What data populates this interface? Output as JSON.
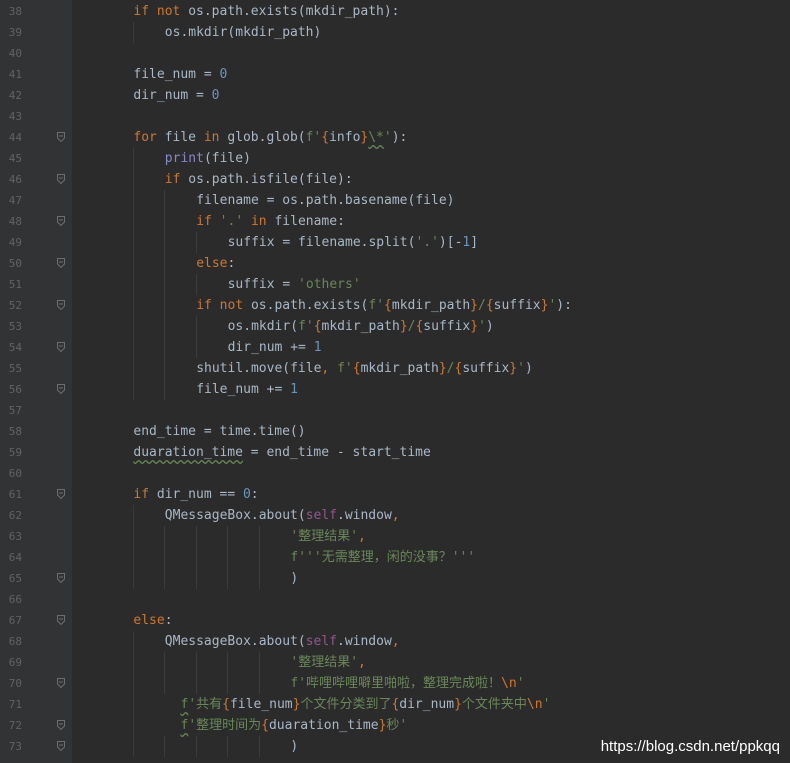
{
  "editor": {
    "lines": [
      {
        "n": "38",
        "tokens": [
          [
            "kw",
            "if "
          ],
          [
            "kw",
            "not "
          ],
          [
            "",
            "os.path.exists(mkdir_path):"
          ]
        ],
        "indent": 8,
        "fold": false
      },
      {
        "n": "39",
        "tokens": [
          [
            "",
            "os.mkdir(mkdir_path)"
          ]
        ],
        "indent": 12,
        "fold": false
      },
      {
        "n": "40",
        "tokens": [],
        "indent": 0,
        "fold": false
      },
      {
        "n": "41",
        "tokens": [
          [
            "",
            "file_num = "
          ],
          [
            "num",
            "0"
          ]
        ],
        "indent": 8,
        "fold": false
      },
      {
        "n": "42",
        "tokens": [
          [
            "",
            "dir_num = "
          ],
          [
            "num",
            "0"
          ]
        ],
        "indent": 8,
        "fold": false
      },
      {
        "n": "43",
        "tokens": [],
        "indent": 0,
        "fold": false
      },
      {
        "n": "44",
        "tokens": [
          [
            "kw",
            "for "
          ],
          [
            "",
            "file "
          ],
          [
            "kw",
            "in "
          ],
          [
            "",
            "glob.glob("
          ],
          [
            "str",
            "f'"
          ],
          [
            "kw",
            "{"
          ],
          [
            "",
            "info"
          ],
          [
            "kw",
            "}"
          ],
          [
            "str squig",
            "\\*"
          ],
          [
            "str",
            "'"
          ],
          [
            "",
            "):"
          ]
        ],
        "indent": 8,
        "fold": true
      },
      {
        "n": "45",
        "tokens": [
          [
            "bi",
            "print"
          ],
          [
            "",
            "(file)"
          ]
        ],
        "indent": 12,
        "fold": false
      },
      {
        "n": "46",
        "tokens": [
          [
            "kw",
            "if "
          ],
          [
            "",
            "os.path.isfile(file):"
          ]
        ],
        "indent": 12,
        "fold": true
      },
      {
        "n": "47",
        "tokens": [
          [
            "",
            "filename = os.path.basename(file)"
          ]
        ],
        "indent": 16,
        "fold": false
      },
      {
        "n": "48",
        "tokens": [
          [
            "kw",
            "if "
          ],
          [
            "str",
            "'.'"
          ],
          [
            "kw",
            " in "
          ],
          [
            "",
            "filename:"
          ]
        ],
        "indent": 16,
        "fold": true
      },
      {
        "n": "49",
        "tokens": [
          [
            "",
            "suffix = filename.split("
          ],
          [
            "str",
            "'.'"
          ],
          [
            "",
            ")[-"
          ],
          [
            "num",
            "1"
          ],
          [
            "",
            "]"
          ]
        ],
        "indent": 20,
        "fold": false
      },
      {
        "n": "50",
        "tokens": [
          [
            "kw",
            "else"
          ],
          [
            "",
            ":"
          ]
        ],
        "indent": 16,
        "fold": true
      },
      {
        "n": "51",
        "tokens": [
          [
            "",
            "suffix = "
          ],
          [
            "str",
            "'others'"
          ]
        ],
        "indent": 20,
        "fold": false
      },
      {
        "n": "52",
        "tokens": [
          [
            "kw",
            "if "
          ],
          [
            "kw",
            "not "
          ],
          [
            "",
            "os.path.exists("
          ],
          [
            "str",
            "f'"
          ],
          [
            "kw",
            "{"
          ],
          [
            "",
            "mkdir_path"
          ],
          [
            "kw",
            "}"
          ],
          [
            "str",
            "/"
          ],
          [
            "kw",
            "{"
          ],
          [
            "",
            "suffix"
          ],
          [
            "kw",
            "}"
          ],
          [
            "str",
            "'"
          ],
          [
            "",
            "):"
          ]
        ],
        "indent": 16,
        "fold": true
      },
      {
        "n": "53",
        "tokens": [
          [
            "",
            "os.mkdir("
          ],
          [
            "str",
            "f'"
          ],
          [
            "kw",
            "{"
          ],
          [
            "",
            "mkdir_path"
          ],
          [
            "kw",
            "}"
          ],
          [
            "str",
            "/"
          ],
          [
            "kw",
            "{"
          ],
          [
            "",
            "suffix"
          ],
          [
            "kw",
            "}"
          ],
          [
            "str",
            "'"
          ],
          [
            "",
            ")"
          ]
        ],
        "indent": 20,
        "fold": false
      },
      {
        "n": "54",
        "tokens": [
          [
            "",
            "dir_num += "
          ],
          [
            "num",
            "1"
          ]
        ],
        "indent": 20,
        "fold": true
      },
      {
        "n": "55",
        "tokens": [
          [
            "",
            "shutil.move(file"
          ],
          [
            "kw",
            ", "
          ],
          [
            "str",
            "f'"
          ],
          [
            "kw",
            "{"
          ],
          [
            "",
            "mkdir_path"
          ],
          [
            "kw",
            "}"
          ],
          [
            "str",
            "/"
          ],
          [
            "kw",
            "{"
          ],
          [
            "",
            "suffix"
          ],
          [
            "kw",
            "}"
          ],
          [
            "str",
            "'"
          ],
          [
            "",
            ")"
          ]
        ],
        "indent": 16,
        "fold": false
      },
      {
        "n": "56",
        "tokens": [
          [
            "",
            "file_num += "
          ],
          [
            "num",
            "1"
          ]
        ],
        "indent": 16,
        "fold": true
      },
      {
        "n": "57",
        "tokens": [],
        "indent": 0,
        "fold": false
      },
      {
        "n": "58",
        "tokens": [
          [
            "",
            "end_time = time.time()"
          ]
        ],
        "indent": 8,
        "fold": false
      },
      {
        "n": "59",
        "tokens": [
          [
            "squig2",
            "duaration_time"
          ],
          [
            "",
            " = end_time - start_time"
          ]
        ],
        "indent": 8,
        "fold": false
      },
      {
        "n": "60",
        "tokens": [],
        "indent": 0,
        "fold": false
      },
      {
        "n": "61",
        "tokens": [
          [
            "kw",
            "if "
          ],
          [
            "",
            "dir_num == "
          ],
          [
            "num",
            "0"
          ],
          [
            "",
            ":"
          ]
        ],
        "indent": 8,
        "fold": true
      },
      {
        "n": "62",
        "tokens": [
          [
            "",
            "QMessageBox.about("
          ],
          [
            "self",
            "self"
          ],
          [
            "",
            ".window"
          ],
          [
            "kw",
            ","
          ]
        ],
        "indent": 12,
        "fold": false
      },
      {
        "n": "63",
        "tokens": [
          [
            "str",
            "'整理结果'"
          ],
          [
            "kw",
            ","
          ]
        ],
        "indent": 28,
        "fold": false
      },
      {
        "n": "64",
        "tokens": [
          [
            "str",
            "f'''无需整理，闲的没事？'''"
          ]
        ],
        "indent": 28,
        "fold": false
      },
      {
        "n": "65",
        "tokens": [
          [
            "",
            ")"
          ]
        ],
        "indent": 28,
        "fold": true
      },
      {
        "n": "66",
        "tokens": [],
        "indent": 0,
        "fold": false
      },
      {
        "n": "67",
        "tokens": [
          [
            "kw",
            "else"
          ],
          [
            "",
            ":"
          ]
        ],
        "indent": 8,
        "fold": true
      },
      {
        "n": "68",
        "tokens": [
          [
            "",
            "QMessageBox.about("
          ],
          [
            "self",
            "self"
          ],
          [
            "",
            ".window"
          ],
          [
            "kw",
            ","
          ]
        ],
        "indent": 12,
        "fold": false
      },
      {
        "n": "69",
        "tokens": [
          [
            "str",
            "'整理结果'"
          ],
          [
            "kw",
            ","
          ]
        ],
        "indent": 28,
        "fold": false
      },
      {
        "n": "70",
        "tokens": [
          [
            "str",
            "f'哔哩哔哩噼里啪啦，整理完成啦！"
          ],
          [
            "kw",
            "\\n"
          ],
          [
            "str",
            "'"
          ]
        ],
        "indent": 28,
        "fold": true
      },
      {
        "n": "71",
        "tokens": [
          [
            "str squig",
            "f"
          ],
          [
            "str",
            "'共有"
          ],
          [
            "kw",
            "{"
          ],
          [
            "",
            "file_num"
          ],
          [
            "kw",
            "}"
          ],
          [
            "str",
            "个文件分类到了"
          ],
          [
            "kw",
            "{"
          ],
          [
            "",
            "dir_num"
          ],
          [
            "kw",
            "}"
          ],
          [
            "str",
            "个文件夹中"
          ],
          [
            "kw",
            "\\n"
          ],
          [
            "str",
            "'"
          ]
        ],
        "indent": 14,
        "fold": false
      },
      {
        "n": "72",
        "tokens": [
          [
            "str squig",
            "f"
          ],
          [
            "str",
            "'整理时间为"
          ],
          [
            "kw",
            "{"
          ],
          [
            "",
            "duaration_time"
          ],
          [
            "kw",
            "}"
          ],
          [
            "str",
            "秒'"
          ]
        ],
        "indent": 14,
        "fold": true
      },
      {
        "n": "73",
        "tokens": [
          [
            "",
            ")"
          ]
        ],
        "indent": 28,
        "fold": true
      }
    ]
  },
  "watermark": "https://blog.csdn.net/ppkqq",
  "colors": {
    "background": "#2b2b2b",
    "keyword": "#cc7832",
    "number": "#6897bb",
    "string": "#6a8759",
    "self": "#94558d",
    "builtin": "#8888c6",
    "text": "#a9b7c6"
  }
}
